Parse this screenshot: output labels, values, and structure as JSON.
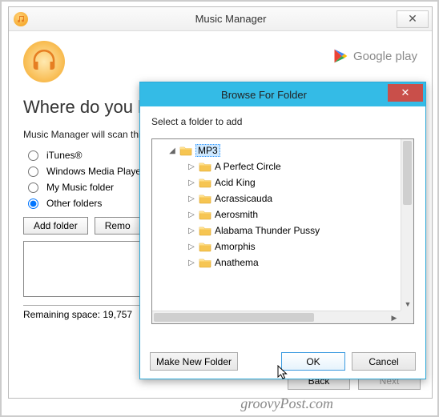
{
  "main_window": {
    "title": "Music Manager",
    "brand": "Google play",
    "heading": "Where do you k",
    "subtext": "Music Manager will scan this",
    "radios": {
      "itunes": "iTunes®",
      "wmp": "Windows Media Player",
      "mymusic": "My Music folder",
      "other": "Other folders"
    },
    "selected_radio": "other",
    "add_folder_btn": "Add folder",
    "remove_btn": "Remo",
    "remaining": "Remaining space: 19,757",
    "back_btn": "Back",
    "next_btn": "Next"
  },
  "dialog": {
    "title": "Browse For Folder",
    "instruction": "Select a folder to add",
    "root_folder": "MP3",
    "children": [
      "A Perfect Circle",
      "Acid King",
      "Acrassicauda",
      "Aerosmith",
      "Alabama Thunder Pussy",
      "Amorphis",
      "Anathema"
    ],
    "make_new": "Make New Folder",
    "ok": "OK",
    "cancel": "Cancel"
  },
  "watermark": "groovyPost.com"
}
